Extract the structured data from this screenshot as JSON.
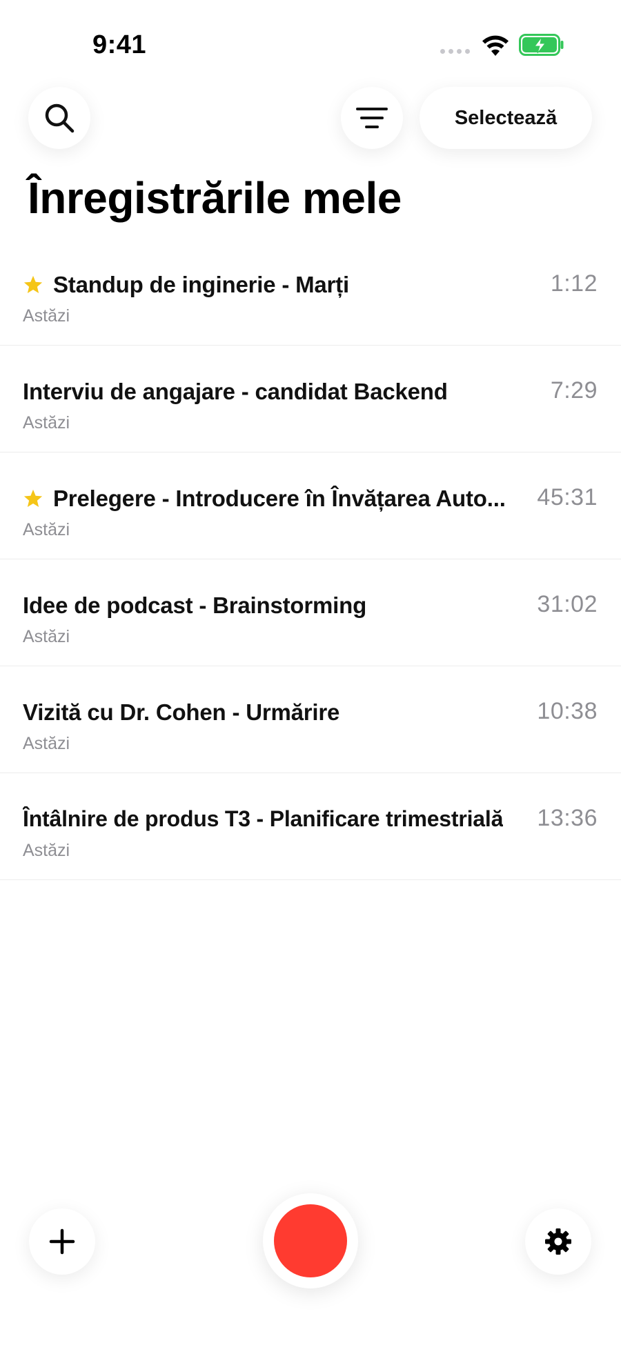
{
  "status_bar": {
    "time": "9:41"
  },
  "toolbar": {
    "search_icon": "search-icon",
    "filter_icon": "filter-icon",
    "select_label": "Selectează"
  },
  "page_title": "Înregistrările mele",
  "recordings": [
    {
      "title": "Standup de inginerie - Marți",
      "date": "Astăzi",
      "duration": "1:12",
      "starred": true
    },
    {
      "title": "Interviu de angajare - candidat Backend",
      "date": "Astăzi",
      "duration": "7:29",
      "starred": false
    },
    {
      "title": "Prelegere - Introducere în Învățarea Auto...",
      "date": "Astăzi",
      "duration": "45:31",
      "starred": true
    },
    {
      "title": "Idee de podcast - Brainstorming",
      "date": "Astăzi",
      "duration": "31:02",
      "starred": false
    },
    {
      "title": "Vizită cu Dr. Cohen - Urmărire",
      "date": "Astăzi",
      "duration": "10:38",
      "starred": false
    },
    {
      "title": "Întâlnire de produs T3 - Planificare trimestrială",
      "date": "Astăzi",
      "duration": "13:36",
      "starred": false
    }
  ],
  "bottom_bar": {
    "add_icon": "plus-icon",
    "record_icon": "record-icon",
    "settings_icon": "gear-icon"
  },
  "colors": {
    "record": "#ff3b30",
    "star": "#f5c518",
    "battery": "#34c759",
    "secondary_text": "#8e8e93"
  }
}
